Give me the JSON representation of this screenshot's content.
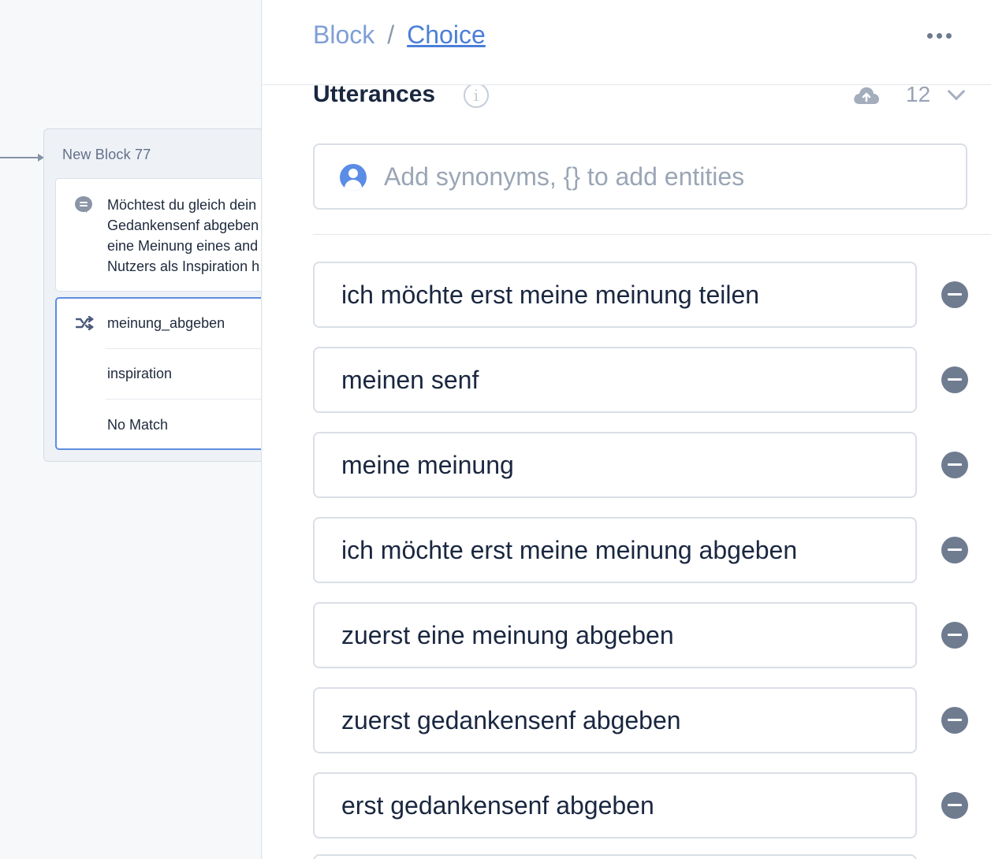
{
  "canvas": {
    "block": {
      "title": "New Block 77",
      "speak_text": "Möchtest du gleich dein\nGedankensenf abgeben\neine Meinung eines and\nNutzers als Inspiration h",
      "choices": [
        "meinung_abgeben",
        "inspiration",
        "No Match"
      ]
    }
  },
  "panel": {
    "breadcrumb": {
      "parent": "Block",
      "separator": "/",
      "current": "Choice"
    },
    "utterances": {
      "title": "Utterances",
      "info_symbol": "i",
      "count": "12",
      "input_placeholder": "Add synonyms, {} to add entities",
      "items": [
        "ich möchte erst meine meinung teilen",
        "meinen senf",
        "meine meinung",
        "ich möchte erst meine meinung abgeben",
        "zuerst eine meinung abgeben",
        "zuerst gedankensenf abgeben",
        "erst gedankensenf abgeben"
      ]
    }
  },
  "colors": {
    "accent_blue": "#4a7fd8",
    "remove_button": "#6f7c90",
    "text_dark": "#1a2740"
  },
  "icons": [
    "chat-bubble-icon",
    "shuffle-icon",
    "more-icon",
    "info-icon",
    "cloud-upload-icon",
    "chevron-down-icon",
    "person-icon",
    "remove-icon"
  ]
}
